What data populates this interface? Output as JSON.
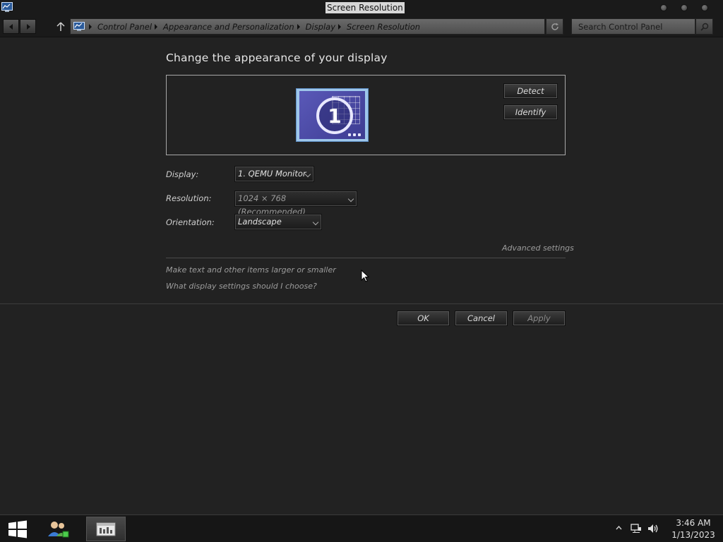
{
  "window": {
    "title": "Screen Resolution"
  },
  "nav": {
    "breadcrumbs": [
      "Control Panel",
      "Appearance and Personalization",
      "Display",
      "Screen Resolution"
    ],
    "search_placeholder": "Search Control Panel"
  },
  "main": {
    "heading": "Change the appearance of your display",
    "monitor_number": "1",
    "detect_label": "Detect",
    "identify_label": "Identify",
    "display_label": "Display:",
    "display_value": "1. QEMU Monitor",
    "resolution_label": "Resolution:",
    "resolution_value": "1024 × 768 (Recommended)",
    "orientation_label": "Orientation:",
    "orientation_value": "Landscape",
    "advanced_link": "Advanced settings",
    "link_text_size": "Make text and other items larger or smaller",
    "link_help": "What display settings should I choose?",
    "ok_label": "OK",
    "cancel_label": "Cancel",
    "apply_label": "Apply"
  },
  "taskbar": {
    "time": "3:46 AM",
    "date": "1/13/2023"
  },
  "colors": {
    "background": "#222222",
    "titlebar": "#1a1a1a",
    "monitor_blue": "#4a49a6"
  },
  "icons": [
    "control-panel-icon",
    "back-arrow-icon",
    "forward-arrow-icon",
    "up-arrow-icon",
    "refresh-icon",
    "search-icon",
    "windows-logo-icon",
    "users-icon",
    "server-manager-icon",
    "network-icon",
    "volume-icon",
    "show-hidden-icon"
  ]
}
